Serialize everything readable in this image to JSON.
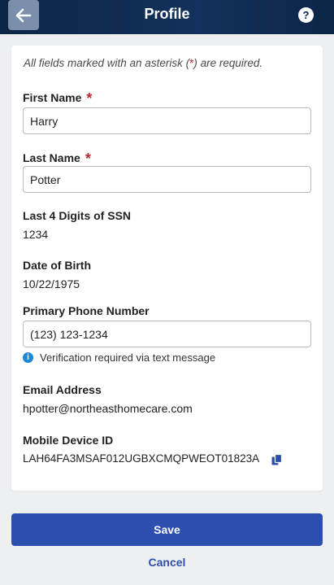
{
  "header": {
    "title": "Profile",
    "back_icon": "arrow-left-icon",
    "help_icon": "question-icon",
    "help_glyph": "?"
  },
  "form": {
    "required_note_prefix": "All fields marked with an asterisk (",
    "required_note_asterisk": "*",
    "required_note_suffix": ") are required.",
    "required_marker": "*",
    "first_name": {
      "label": "First Name",
      "value": "Harry"
    },
    "last_name": {
      "label": "Last Name",
      "value": "Potter"
    },
    "ssn": {
      "label": "Last 4 Digits of SSN",
      "value": "1234"
    },
    "dob": {
      "label": "Date of Birth",
      "value": "10/22/1975"
    },
    "phone": {
      "label": "Primary Phone Number",
      "value": "(123) 123-1234",
      "info_glyph": "i",
      "info": "Verification required via text message"
    },
    "email": {
      "label": "Email Address",
      "value": "hpotter@northeasthomecare.com"
    },
    "device": {
      "label": "Mobile Device ID",
      "value": "LAH64FA3MSAF012UGBXCMQPWEOT01823A",
      "copy_icon": "copy-icon"
    }
  },
  "actions": {
    "save_label": "Save",
    "cancel_label": "Cancel"
  },
  "colors": {
    "header_bg": "#0b2545",
    "accent": "#2b4eaf",
    "required": "#c0262d",
    "info": "#1e88d6"
  }
}
